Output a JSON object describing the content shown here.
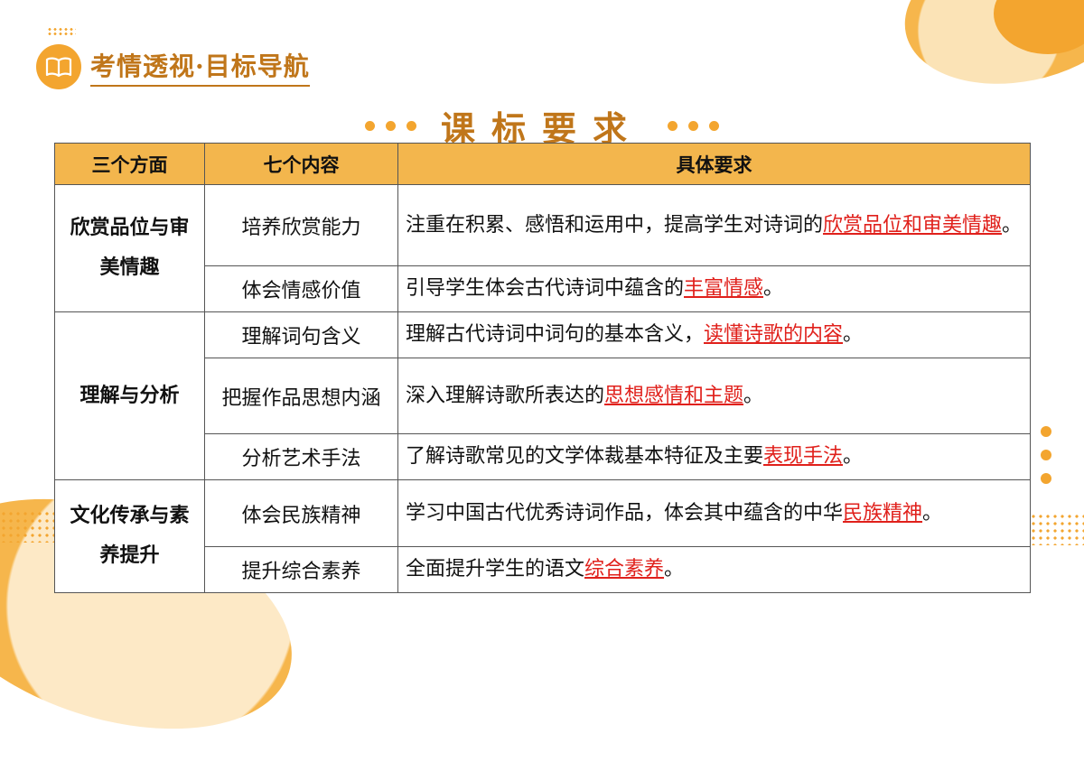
{
  "header": {
    "title": "考情透视·目标导航",
    "icon": "open-book-icon"
  },
  "section_title": "课标要求",
  "colors": {
    "accent": "#f3b64d",
    "title": "#c0761a",
    "highlight": "#e0201b"
  },
  "table": {
    "headers": [
      "三个方面",
      "七个内容",
      "具体要求"
    ],
    "groups": [
      {
        "aspect": "欣赏品位与审美情趣",
        "rows": [
          {
            "content": "培养欣赏能力",
            "pre": "注重在积累、感悟和运用中，提高学生对诗词的",
            "hl": "欣赏品位和审美情趣",
            "post": "。"
          },
          {
            "content": "体会情感价值",
            "pre": "引导学生体会古代诗词中蕴含的",
            "hl": "丰富情感",
            "post": "。"
          }
        ]
      },
      {
        "aspect": "理解与分析",
        "rows": [
          {
            "content": "理解词句含义",
            "pre": "理解古代诗词中词句的基本含义，",
            "hl": "读懂诗歌的内容",
            "post": "。"
          },
          {
            "content": "把握作品思想内涵",
            "pre": "深入理解诗歌所表达的",
            "hl": "思想感情和主题",
            "post": "。"
          },
          {
            "content": "分析艺术手法",
            "pre": "了解诗歌常见的文学体裁基本特征及主要",
            "hl": "表现手法",
            "post": "。"
          }
        ]
      },
      {
        "aspect": "文化传承与素养提升",
        "rows": [
          {
            "content": "体会民族精神",
            "pre": "学习中国古代优秀诗词作品，体会其中蕴含的中华",
            "hl": "民族精神",
            "post": "。"
          },
          {
            "content": "提升综合素养",
            "pre": "全面提升学生的语文",
            "hl": "综合素养",
            "post": "。"
          }
        ]
      }
    ]
  }
}
